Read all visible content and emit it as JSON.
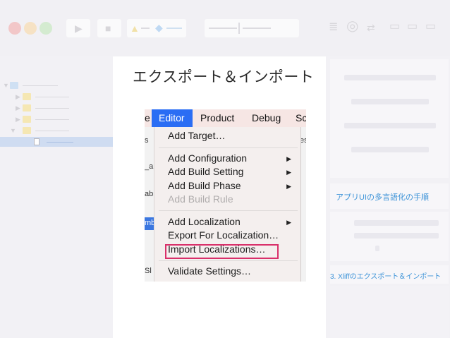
{
  "slide": {
    "title": "エクスポート＆インポート"
  },
  "menubar": {
    "items": [
      "e",
      "Editor",
      "Product",
      "Debug",
      "Sc"
    ],
    "active": "Editor"
  },
  "behind_window": {
    "left_texts": [
      "s",
      "_ap",
      "abi",
      "mb",
      "Sl"
    ],
    "right_text": "es"
  },
  "menu": {
    "items": [
      {
        "label": "Add Target…",
        "submenu": false,
        "disabled": false
      },
      {
        "label": "Add Configuration",
        "submenu": true,
        "disabled": false
      },
      {
        "label": "Add Build Setting",
        "submenu": true,
        "disabled": false
      },
      {
        "label": "Add Build Phase",
        "submenu": true,
        "disabled": false
      },
      {
        "label": "Add Build Rule",
        "submenu": false,
        "disabled": true
      },
      {
        "label": "Add Localization",
        "submenu": true,
        "disabled": false
      },
      {
        "label": "Export For Localization…",
        "submenu": false,
        "disabled": false
      },
      {
        "label": "Import Localizations…",
        "submenu": false,
        "disabled": false,
        "highlighted": true
      },
      {
        "label": "Validate Settings…",
        "submenu": false,
        "disabled": false
      }
    ],
    "submenu_glyph": "▶",
    "highlight_color": "#d9306a"
  },
  "inspector": {
    "section_title": "アプリUIの多言語化の手順",
    "step_label": "3. Xliffのエクスポート＆インポート"
  },
  "colors": {
    "menu_selection": "#2a6df4",
    "link_blue": "#3c93d8",
    "traffic_red": "#f2c7c8",
    "traffic_yellow": "#f6e2c4",
    "traffic_green": "#d4ebd0"
  }
}
